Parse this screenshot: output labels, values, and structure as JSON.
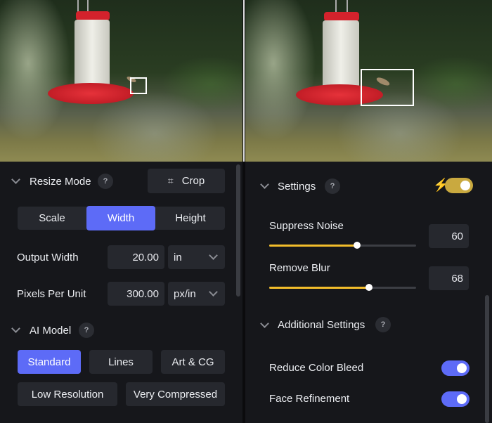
{
  "left": {
    "resize_mode": {
      "title": "Resize Mode",
      "help": "?",
      "crop_label": "Crop"
    },
    "modes": [
      {
        "label": "Scale",
        "active": false
      },
      {
        "label": "Width",
        "active": true
      },
      {
        "label": "Height",
        "active": false
      }
    ],
    "output_width": {
      "label": "Output Width",
      "value": "20.00",
      "unit": "in"
    },
    "pixels_per_unit": {
      "label": "Pixels Per Unit",
      "value": "300.00",
      "unit": "px/in"
    },
    "ai_model": {
      "title": "AI Model",
      "help": "?",
      "options": [
        {
          "label": "Standard",
          "active": true
        },
        {
          "label": "Lines",
          "active": false
        },
        {
          "label": "Art & CG",
          "active": false
        },
        {
          "label": "Low Resolution",
          "active": false
        },
        {
          "label": "Very Compressed",
          "active": false
        }
      ]
    }
  },
  "right": {
    "settings": {
      "title": "Settings",
      "help": "?",
      "auto_enabled": true
    },
    "suppress_noise": {
      "label": "Suppress Noise",
      "value": "60",
      "percent": 60
    },
    "remove_blur": {
      "label": "Remove Blur",
      "value": "68",
      "percent": 68
    },
    "additional": {
      "title": "Additional Settings",
      "help": "?"
    },
    "reduce_color_bleed": {
      "label": "Reduce Color Bleed",
      "enabled": true
    },
    "face_refinement": {
      "label": "Face Refinement",
      "enabled": true
    }
  },
  "colors": {
    "accent": "#5d6bf7",
    "slider": "#f2bd2b",
    "toggle_gold": "#c9a93f",
    "bg": "#16171b",
    "control": "#26282e"
  }
}
